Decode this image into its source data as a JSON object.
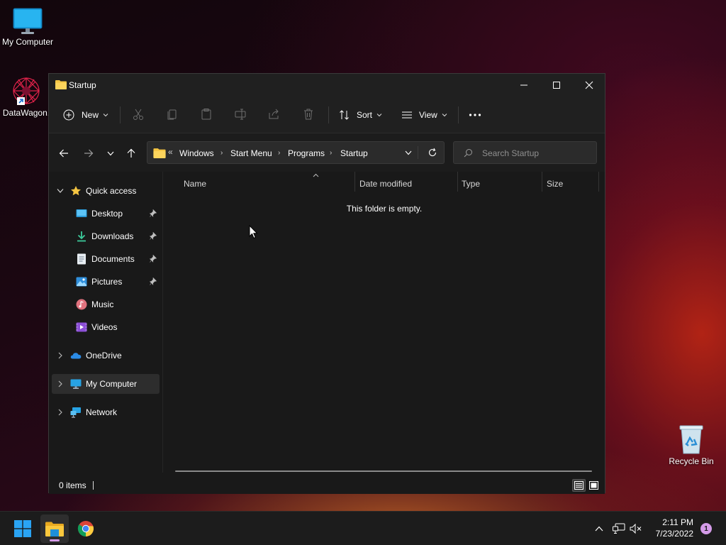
{
  "desktop": {
    "icons": [
      {
        "label": "My Computer",
        "icon": "monitor-icon"
      },
      {
        "label": "DataWagon.",
        "icon": "datawagon-shortcut-icon"
      },
      {
        "label": "Recycle Bin",
        "icon": "recycle-bin-icon"
      }
    ]
  },
  "window": {
    "title": "Startup",
    "controls": {
      "minimize": "minimize-icon",
      "maximize": "maximize-icon",
      "close": "close-icon"
    }
  },
  "toolbar": {
    "new_label": "New",
    "sort_label": "Sort",
    "view_label": "View",
    "more_icon": "more-icon"
  },
  "address": {
    "overflow": "«",
    "crumbs": [
      "Windows",
      "Start Menu",
      "Programs",
      "Startup"
    ]
  },
  "search": {
    "placeholder": "Search Startup"
  },
  "sidebar": {
    "quick_access": "Quick access",
    "items": [
      {
        "label": "Desktop",
        "icon": "desktop-folder-icon",
        "pinned": true
      },
      {
        "label": "Downloads",
        "icon": "downloads-icon",
        "pinned": true
      },
      {
        "label": "Documents",
        "icon": "documents-icon",
        "pinned": true
      },
      {
        "label": "Pictures",
        "icon": "pictures-icon",
        "pinned": true
      },
      {
        "label": "Music",
        "icon": "music-icon",
        "pinned": false
      },
      {
        "label": "Videos",
        "icon": "videos-icon",
        "pinned": false
      }
    ],
    "roots": [
      {
        "label": "OneDrive",
        "icon": "onedrive-icon"
      },
      {
        "label": "My Computer",
        "icon": "computer-icon",
        "selected": true
      },
      {
        "label": "Network",
        "icon": "network-icon"
      }
    ]
  },
  "content": {
    "columns": [
      "Name",
      "Date modified",
      "Type",
      "Size"
    ],
    "empty_message": "This folder is empty."
  },
  "status": {
    "items_text": "0 items"
  },
  "taskbar": {
    "apps": [
      "start-icon",
      "file-explorer-icon",
      "chrome-icon"
    ],
    "time": "2:11 PM",
    "date": "7/23/2022",
    "notification_count": "1"
  },
  "colors": {
    "window_bg": "#191919",
    "accent_folder": "#f5c542",
    "selected_bg": "#2d2d2d"
  }
}
